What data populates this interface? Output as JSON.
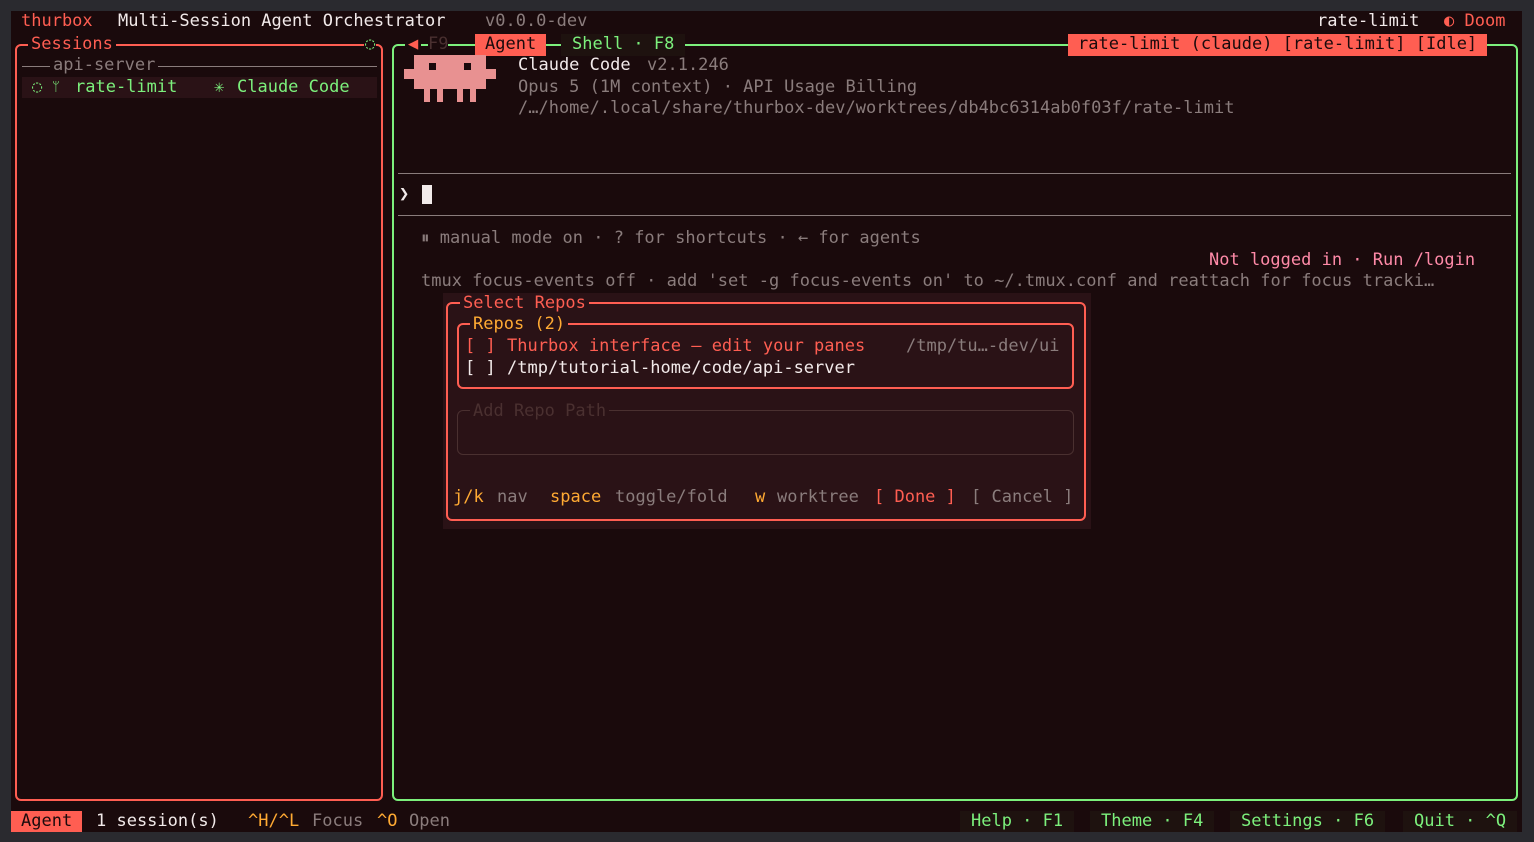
{
  "titlebar": {
    "app_name": "thurbox",
    "subtitle": "Multi-Session Agent Orchestrator",
    "version": "v0.0.0-dev",
    "current_session": "rate-limit",
    "theme_icon": "◐",
    "theme_name": "Doom"
  },
  "sessions_panel": {
    "title": "Sessions",
    "corner_icon": "◌",
    "group_name": "api-server",
    "items": [
      {
        "spinner": "◌",
        "branch_icon": "ᛘ",
        "name": "rate-limit",
        "agent_icon": "✳",
        "agent": "Claude Code"
      }
    ]
  },
  "agent_panel": {
    "nav_arrow": "◀",
    "nav_key": "F9",
    "tabs": [
      {
        "label": "Agent",
        "active": true
      },
      {
        "label": "Shell · F8",
        "active": false
      }
    ],
    "status_label": "rate-limit (claude) [rate-limit] [Idle]",
    "app_title": "Claude Code",
    "app_version": "v2.1.246",
    "model_line": "Opus 5 (1M context) · API Usage Billing",
    "path_line": "/…/home/.local/share/thurbox-dev/worktrees/db4bc6314ab0f03f/rate-limit",
    "prompt_char": "❯",
    "mode_line": "⏸ manual mode on · ? for shortcuts · ← for agents",
    "login_line": "Not logged in · Run /login",
    "tmux_line": "tmux focus-events off · add 'set -g focus-events on' to ~/.tmux.conf and reattach for focus tracki…"
  },
  "dialog": {
    "title": "Select Repos",
    "repos_title": "Repos (2)",
    "repos": [
      {
        "checkbox": "[ ]",
        "name": "Thurbox interface — edit your panes",
        "path": "/tmp/tu…-dev/ui"
      },
      {
        "checkbox": "[ ]",
        "name": "/tmp/tutorial-home/code/api-server",
        "path": ""
      }
    ],
    "add_path_title": "Add Repo Path",
    "add_path_value": "",
    "hints": [
      {
        "key": "j/k",
        "desc": "nav"
      },
      {
        "key": "space",
        "desc": "toggle/fold"
      },
      {
        "key": "w",
        "desc": "worktree"
      }
    ],
    "done_label": "[ Done ]",
    "cancel_label": "[ Cancel ]"
  },
  "statusbar": {
    "mode": "Agent",
    "session_count": "1 session(s)",
    "hint1_key": "^H/^L",
    "hint1_desc": "Focus",
    "hint2_key": "^O",
    "hint2_desc": "Open",
    "buttons": [
      {
        "label": "Help · F1"
      },
      {
        "label": "Theme · F4"
      },
      {
        "label": "Settings · F6"
      },
      {
        "label": "Quit · ^Q"
      }
    ]
  },
  "colors": {
    "background": "#1a0a0c",
    "accent_red": "#ff5e52",
    "accent_green": "#7cf07c",
    "accent_orange": "#ffaa33",
    "login_pink": "#ff8aa8",
    "mascot": "#e89191"
  }
}
